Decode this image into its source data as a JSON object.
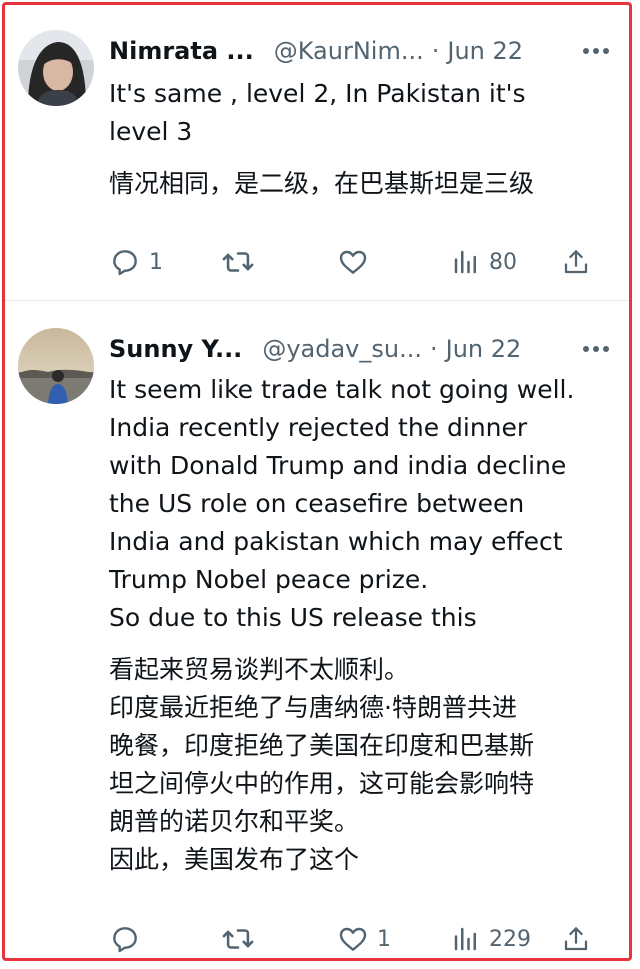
{
  "tweets": [
    {
      "author_name": "Nimrata ...",
      "handle": "@KaurNim...",
      "separator": "·",
      "date": "Jun 22",
      "text": "It's same , level 2, In Pakistan it's\nlevel 3",
      "translation": "情况相同，是二级，在巴基斯坦是三级",
      "replies": "1",
      "retweets": "",
      "likes": "",
      "views": "80"
    },
    {
      "author_name": "Sunny Y...",
      "handle": "@yadav_su...",
      "separator": "·",
      "date": "Jun 22",
      "text": "It seem like trade talk not going well.\nIndia recently rejected the dinner\nwith Donald Trump and india decline\nthe US role on ceasefire between\nIndia and pakistan which may effect\nTrump Nobel peace prize.\nSo due to this US release this",
      "translation": "看起来贸易谈判不太顺利。\n印度最近拒绝了与唐纳德·特朗普共进\n晚餐，印度拒绝了美国在印度和巴基斯\n坦之间停火中的作用，这可能会影响特\n朗普的诺贝尔和平奖。\n因此，美国发布了这个",
      "replies": "",
      "retweets": "",
      "likes": "1",
      "views": "229"
    }
  ],
  "icons": {
    "more": "more-icon",
    "reply": "reply-icon",
    "retweet": "retweet-icon",
    "like": "like-icon",
    "views": "views-icon",
    "share": "share-icon"
  },
  "colors": {
    "border": "#e8323c",
    "text": "#0f1419",
    "secondary": "#536471",
    "divider": "#e6e9eb"
  }
}
